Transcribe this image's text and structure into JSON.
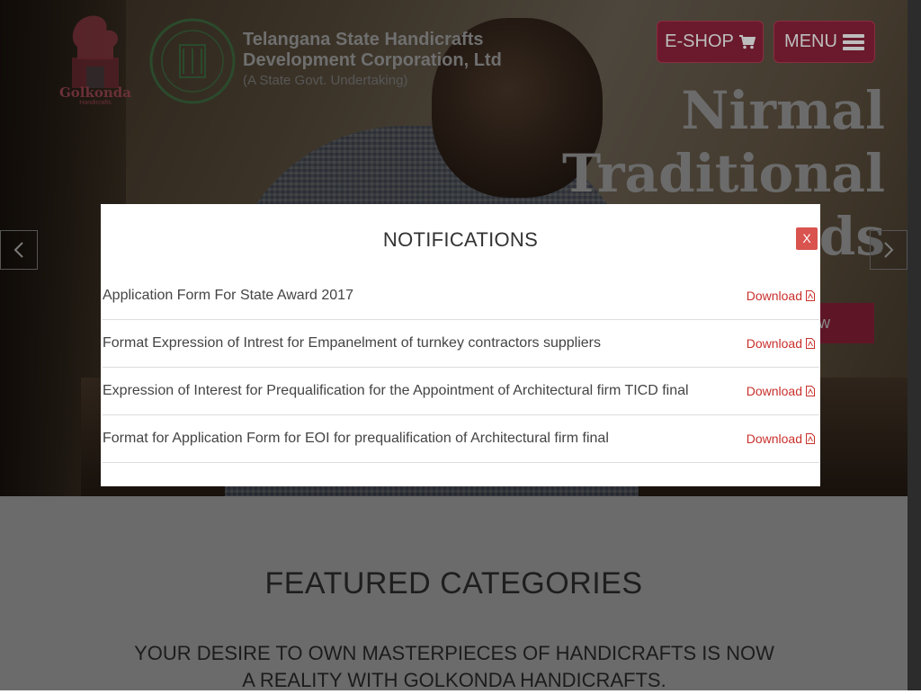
{
  "header": {
    "brand_line1": "Telangana State Handicrafts",
    "brand_line2": "Development Corporation, Ltd",
    "brand_line3": "(A State Govt. Undertaking)",
    "logo_golkonda_text": "Golkonda",
    "logo_golkonda_sub": "Handicrafts",
    "eshop_label": "E-SHOP",
    "menu_label": "MENU"
  },
  "slide": {
    "title_line1": "Nirmal",
    "title_line2": "Traditional",
    "title_line3": "rds",
    "shop_label": "ow"
  },
  "modal": {
    "title": "NOTIFICATIONS",
    "close_label": "X",
    "items": [
      {
        "text": "Application Form For State Award 2017",
        "link": "Download"
      },
      {
        "text": "Format Expression of Intrest for Empanelment of turnkey contractors suppliers",
        "link": "Download"
      },
      {
        "text": "Expression of Interest for Prequalification for the Appointment of Architectural firm TICD final",
        "link": "Download"
      },
      {
        "text": "Format for Application Form for EOI for prequalification of Architectural firm final",
        "link": "Download"
      }
    ]
  },
  "featured": {
    "title": "FEATURED CATEGORIES",
    "subtitle": "YOUR DESIRE TO OWN MASTERPIECES OF HANDICRAFTS IS NOW A REALITY WITH GOLKONDA HANDICRAFTS."
  },
  "colors": {
    "brand_maroon": "#6a1a2c",
    "close_red": "#d9534f",
    "download_red": "#c9302c"
  },
  "icons": [
    "shopping-cart-icon",
    "hamburger-menu-icon",
    "chevron-left-icon",
    "chevron-right-icon",
    "pdf-file-icon"
  ]
}
